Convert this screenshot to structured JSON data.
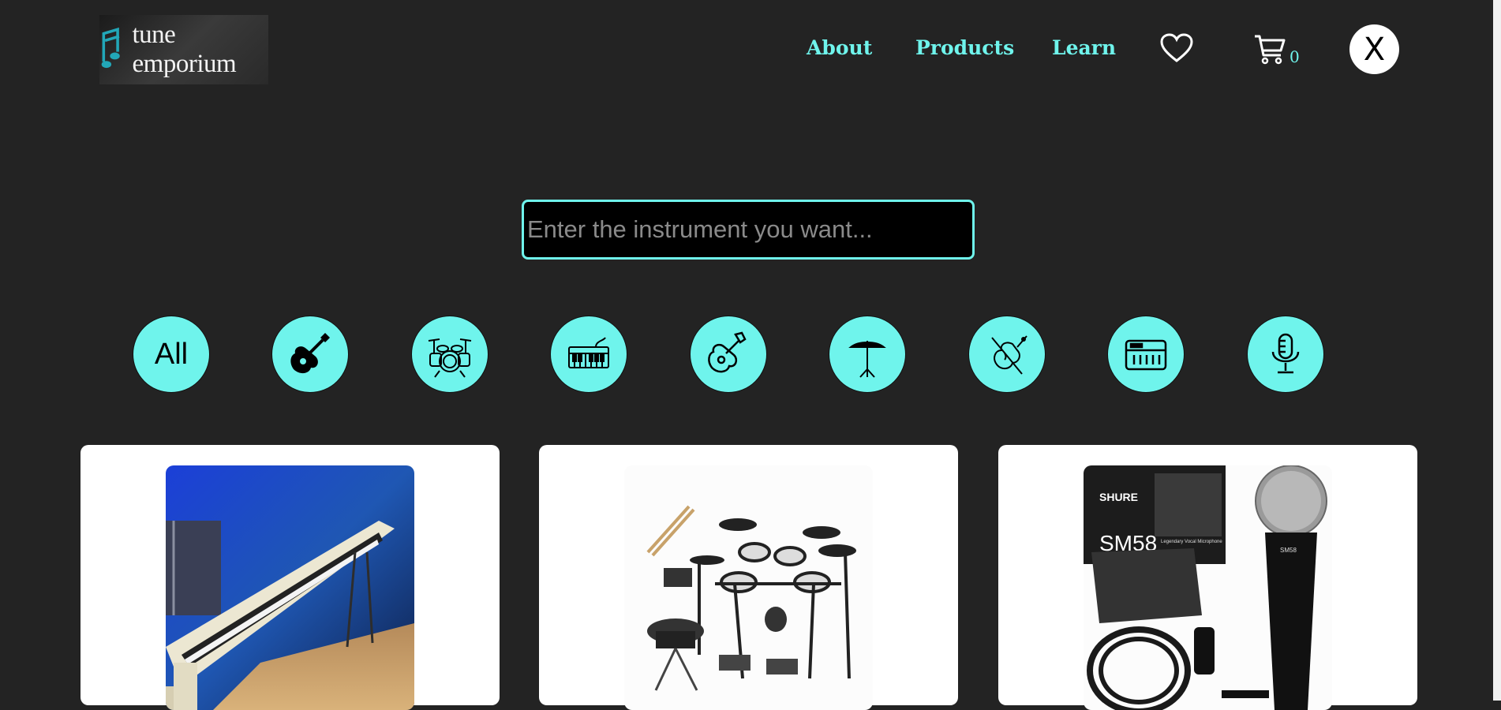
{
  "header": {
    "logo_text": "tune emporium",
    "nav": [
      {
        "label": "About"
      },
      {
        "label": "Products"
      },
      {
        "label": "Learn"
      }
    ],
    "cart_count": "0",
    "close_label": "X"
  },
  "search": {
    "placeholder": "Enter the instrument you want..."
  },
  "categories": [
    {
      "label": "All"
    },
    {
      "icon": "acoustic-guitar-icon"
    },
    {
      "icon": "drum-kit-icon"
    },
    {
      "icon": "keyboard-synth-icon"
    },
    {
      "icon": "ukulele-icon"
    },
    {
      "icon": "cymbal-icon"
    },
    {
      "icon": "violin-icon"
    },
    {
      "icon": "amplifier-icon"
    },
    {
      "icon": "microphone-icon"
    }
  ],
  "products": [
    {
      "image": "digital-piano-image"
    },
    {
      "image": "electronic-drum-kit-image"
    },
    {
      "image": "shure-microphone-image",
      "box_text_brand": "SHURE",
      "box_text_model": "SM58",
      "box_text_sub": "Legendary Vocal Microphone",
      "mic_label": "SM58"
    }
  ],
  "colors": {
    "background": "#232323",
    "accent": "#6ff4ec",
    "card": "#ffffff"
  }
}
